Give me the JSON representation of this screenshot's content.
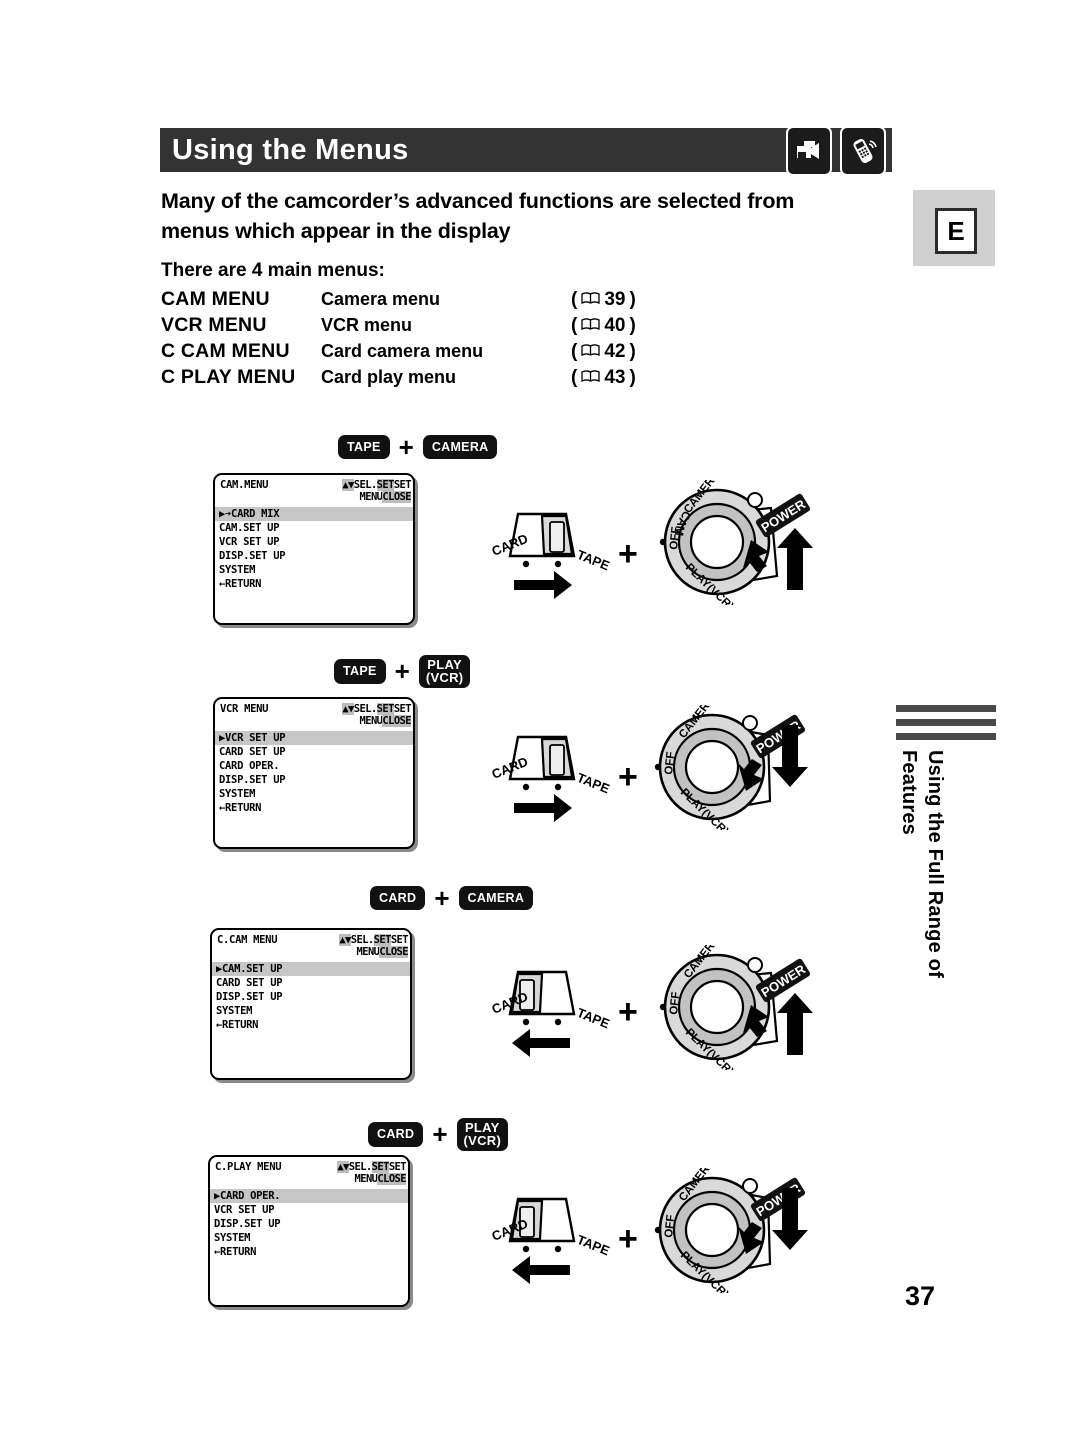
{
  "header": {
    "title": "Using the Menus",
    "icons": [
      {
        "name": "camcorder-icon",
        "label": "camcorder"
      },
      {
        "name": "remote-control-icon",
        "label": "remote"
      }
    ]
  },
  "language_badge": {
    "label": "E"
  },
  "intro": {
    "paragraph": "Many of the camcorder’s advanced functions are selected from menus which appear in the display",
    "subheading": "There are 4 main menus:"
  },
  "menu_table": [
    {
      "code": "CAM  MENU",
      "desc": "Camera menu",
      "open": "(",
      "icon": "book-icon",
      "page": "39",
      "close": ")"
    },
    {
      "code": "VCR MENU",
      "desc": "VCR menu",
      "open": "(",
      "icon": "book-icon",
      "page": "40",
      "close": ")"
    },
    {
      "code": "C CAM  MENU",
      "desc": "Card camera menu",
      "open": "(",
      "icon": "book-icon",
      "page": "42",
      "close": ")"
    },
    {
      "code": "C PLAY MENU",
      "desc": "Card play menu",
      "open": "(",
      "icon": "book-icon",
      "page": "43",
      "close": ")"
    }
  ],
  "groups": [
    {
      "buttons": [
        {
          "line1": "TAPE",
          "line2": ""
        },
        {
          "line1": "CAMERA",
          "line2": ""
        }
      ],
      "plus": "+",
      "screen": {
        "title": "CAM.MENU",
        "hint_arrows": "▲▼",
        "hint1_plain": "SEL.",
        "hint1_hl": "SET",
        "hint1_tail": "SET",
        "hint2_plain": "MENU",
        "hint2_hl": "CLOSE",
        "selected": "▶➔CARD MIX",
        "items": [
          "CAM.SET UP",
          "VCR SET UP",
          "DISP.SET UP",
          "SYSTEM",
          "←RETURN"
        ]
      },
      "switch": {
        "left_label": "CARD",
        "right_label": "TAPE",
        "knob_side": "right",
        "arrow": "right"
      },
      "dial": {
        "power_label": "POWER",
        "positions": [
          "CAMERA",
          "OFF",
          "PLAY(VCR)"
        ],
        "arrow": "up"
      },
      "middle_plus": "+"
    },
    {
      "buttons": [
        {
          "line1": "TAPE",
          "line2": ""
        },
        {
          "line1": "PLAY",
          "line2": "(VCR)"
        }
      ],
      "plus": "+",
      "screen": {
        "title": "VCR MENU",
        "hint_arrows": "▲▼",
        "hint1_plain": "SEL.",
        "hint1_hl": "SET",
        "hint1_tail": "SET",
        "hint2_plain": "MENU",
        "hint2_hl": "CLOSE",
        "selected": "▶VCR SET UP",
        "items": [
          "CARD SET UP",
          "CARD OPER.",
          "DISP.SET UP",
          "SYSTEM",
          "←RETURN"
        ]
      },
      "switch": {
        "left_label": "CARD",
        "right_label": "TAPE",
        "knob_side": "right",
        "arrow": "right"
      },
      "dial": {
        "power_label": "POWER",
        "positions": [
          "CAMERA",
          "OFF",
          "PLAY(VCR)"
        ],
        "arrow": "down"
      },
      "middle_plus": "+"
    },
    {
      "buttons": [
        {
          "line1": "CARD",
          "line2": ""
        },
        {
          "line1": "CAMERA",
          "line2": ""
        }
      ],
      "plus": "+",
      "screen": {
        "title": "C.CAM MENU",
        "hint_arrows": "▲▼",
        "hint1_plain": "SEL.",
        "hint1_hl": "SET",
        "hint1_tail": "SET",
        "hint2_plain": "MENU",
        "hint2_hl": "CLOSE",
        "selected": "▶CAM.SET UP",
        "items": [
          "CARD SET UP",
          "DISP.SET UP",
          "SYSTEM",
          "←RETURN"
        ]
      },
      "switch": {
        "left_label": "CARD",
        "right_label": "TAPE",
        "knob_side": "left",
        "arrow": "left"
      },
      "dial": {
        "power_label": "POWER",
        "positions": [
          "CAMERA",
          "OFF",
          "PLAY(VCR)"
        ],
        "arrow": "up"
      },
      "middle_plus": "+"
    },
    {
      "buttons": [
        {
          "line1": "CARD",
          "line2": ""
        },
        {
          "line1": "PLAY",
          "line2": "(VCR)"
        }
      ],
      "plus": "+",
      "screen": {
        "title": "C.PLAY MENU",
        "hint_arrows": "▲▼",
        "hint1_plain": "SEL.",
        "hint1_hl": "SET",
        "hint1_tail": "SET",
        "hint2_plain": "MENU",
        "hint2_hl": "CLOSE",
        "selected": "▶CARD OPER.",
        "items": [
          "VCR SET UP",
          "DISP.SET UP",
          "SYSTEM",
          "←RETURN"
        ]
      },
      "switch": {
        "left_label": "CARD",
        "right_label": "TAPE",
        "knob_side": "left",
        "arrow": "left"
      },
      "dial": {
        "power_label": "POWER",
        "positions": [
          "CAMERA",
          "OFF",
          "PLAY(VCR)"
        ],
        "arrow": "down"
      },
      "middle_plus": "+"
    }
  ],
  "side_tab": {
    "text": "Using the Full Range of Features"
  },
  "page_number": "37",
  "colors": {
    "header_bg": "#333333",
    "highlight": "#c6c6c6",
    "badge_bg": "#cfcfcf",
    "rule": "#4a4a4a"
  }
}
